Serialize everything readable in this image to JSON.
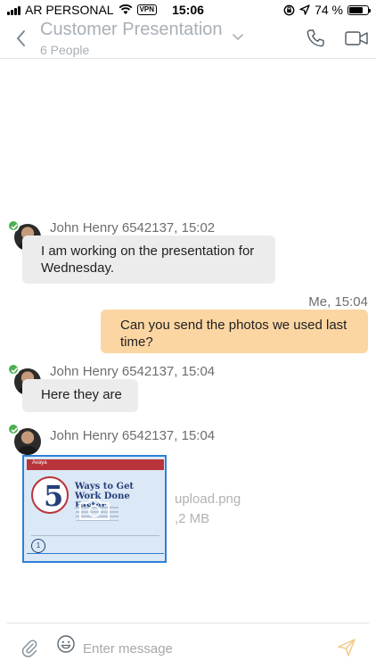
{
  "status_bar": {
    "carrier": "AR PERSONAL",
    "vpn_badge": "VPN",
    "time": "15:06",
    "battery": "74 %",
    "battery_level": 0.74
  },
  "header": {
    "title": "Customer Presentation",
    "subtitle": "6 People",
    "back_icon": "chevron-left-icon",
    "dropdown_icon": "chevron-down-icon",
    "call_icon": "phone-icon",
    "video_icon": "video-camera-icon"
  },
  "messages": [
    {
      "meta": "John Henry 6542137, 15:02",
      "text": "I am working on the presentation for Wednesday."
    },
    {
      "meta": "Me, 15:04",
      "text": "Can you send the photos we used last time?"
    },
    {
      "meta": "John Henry 6542137, 15:04",
      "text": "Here they are"
    },
    {
      "meta": "John Henry 6542137, 15:04",
      "attachment": {
        "file_name": "upload.png",
        "file_size": ",2 MB",
        "preview_header": "Avaya",
        "preview_number": "5",
        "preview_title": "Ways to Get Work Done Faster.",
        "preview_item": "1"
      }
    }
  ],
  "composer": {
    "placeholder": "Enter message",
    "attach_icon": "paperclip-icon",
    "emoji_icon": "smiley-icon",
    "send_icon": "send-icon"
  },
  "colors": {
    "outgoing_bubble": "#fbd6a3",
    "incoming_bubble": "#ececec",
    "online_check": "#4caf50",
    "attachment_border": "#2f7fd8"
  }
}
